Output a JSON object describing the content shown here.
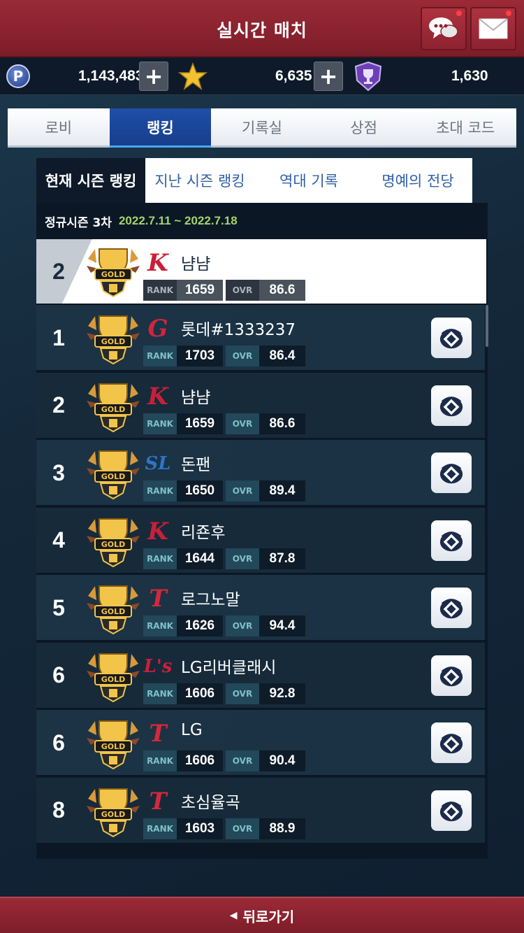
{
  "header": {
    "title": "실시간 매치",
    "chat_icon": "chat-bubbles-icon",
    "mail_icon": "mail-envelope-icon"
  },
  "currency": {
    "points": "1,143,483",
    "stars": "6,635",
    "trophies": "1,630",
    "plus_label": "+",
    "point_icon_letter": "P"
  },
  "main_tabs": [
    "로비",
    "랭킹",
    "기록실",
    "상점",
    "초대 코드"
  ],
  "main_tab_active": 1,
  "sub_tabs": [
    "현재 시즌 랭킹",
    "지난 시즌 랭킹",
    "역대 기록",
    "명예의 전당"
  ],
  "sub_tab_active": 0,
  "season": {
    "label": "정규시즌 3차",
    "dates": "2022.7.11 ~ 2022.7.18"
  },
  "labels": {
    "rank": "RANK",
    "ovr": "OVR",
    "badge": "GOLD"
  },
  "my_entry": {
    "position": "2",
    "logo": "K",
    "logo_color": "#c8203a",
    "name": "냠냠",
    "rank": "1659",
    "ovr": "86.6"
  },
  "entries": [
    {
      "position": "1",
      "logo": "G",
      "logo_color": "#d0253e",
      "name": "롯데#1333237",
      "rank": "1703",
      "ovr": "86.4"
    },
    {
      "position": "2",
      "logo": "K",
      "logo_color": "#c8203a",
      "name": "냠냠",
      "rank": "1659",
      "ovr": "86.6"
    },
    {
      "position": "3",
      "logo": "SL",
      "logo_color": "#2f74c8",
      "name": "돈팬",
      "rank": "1650",
      "ovr": "89.4"
    },
    {
      "position": "4",
      "logo": "K",
      "logo_color": "#c8203a",
      "name": "리죤후",
      "rank": "1644",
      "ovr": "87.8"
    },
    {
      "position": "5",
      "logo": "T",
      "logo_color": "#d4283c",
      "name": "로그노말",
      "rank": "1626",
      "ovr": "94.4"
    },
    {
      "position": "6",
      "logo": "L's",
      "logo_color": "#c8203a",
      "name": "LG리버클래시",
      "rank": "1606",
      "ovr": "92.8"
    },
    {
      "position": "6",
      "logo": "T",
      "logo_color": "#d4283c",
      "name": "LG",
      "rank": "1606",
      "ovr": "90.4"
    },
    {
      "position": "8",
      "logo": "T",
      "logo_color": "#d4283c",
      "name": "초심율곡",
      "rank": "1603",
      "ovr": "88.9"
    }
  ],
  "footer": {
    "back_label": "뒤로가기",
    "arrow": "◀"
  },
  "colors": {
    "header_red": "#8c2230",
    "active_tab_blue": "#1f4fa8",
    "date_green": "#a3d46d"
  }
}
